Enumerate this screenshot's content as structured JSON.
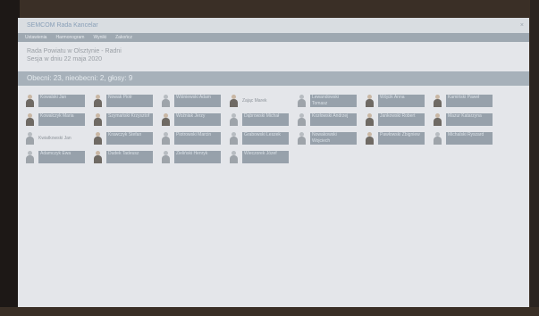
{
  "window": {
    "title": "SEMCOM Rada Kancelar"
  },
  "menu": [
    "Ustawienia",
    "Harmonogram",
    "Wyniki",
    "Zakończ"
  ],
  "header": {
    "org": "Rada Powiatu w Olsztynie - Radni",
    "session": "Sesja w dniu 22 maja 2020"
  },
  "section": {
    "label": "Obecni: 23, nieobecni: 2, głosy: 9"
  },
  "people": [
    {
      "name": "Kowalski Jan",
      "style": "box",
      "avatar": "photo"
    },
    {
      "name": "Nowak Piotr",
      "style": "box",
      "avatar": "photo"
    },
    {
      "name": "Wiśniewski Adam",
      "style": "box",
      "avatar": "gray"
    },
    {
      "name": "Zając Marek",
      "style": "plain",
      "avatar": "photo"
    },
    {
      "name": "Lewandowski Tomasz",
      "style": "box",
      "avatar": "gray"
    },
    {
      "name": "Wójcik Anna",
      "style": "box",
      "avatar": "photo"
    },
    {
      "name": "Kamiński Paweł",
      "style": "box",
      "avatar": "photo"
    },
    {
      "name": "Kowalczyk Maria",
      "style": "box",
      "avatar": "photo"
    },
    {
      "name": "Szymański Krzysztof",
      "style": "box",
      "avatar": "photo"
    },
    {
      "name": "Woźniak Jerzy",
      "style": "box",
      "avatar": "photo"
    },
    {
      "name": "Dąbrowski Michał",
      "style": "box",
      "avatar": "gray"
    },
    {
      "name": "Kozłowski Andrzej",
      "style": "box",
      "avatar": "gray"
    },
    {
      "name": "Jankowski Robert",
      "style": "box",
      "avatar": "photo"
    },
    {
      "name": "Mazur Katarzyna",
      "style": "box",
      "avatar": "photo"
    },
    {
      "name": "Kwiatkowski Jan",
      "style": "plain",
      "avatar": "gray"
    },
    {
      "name": "Krawczyk Stefan",
      "style": "box",
      "avatar": "photo"
    },
    {
      "name": "Piotrowski Marcin",
      "style": "box",
      "avatar": "gray"
    },
    {
      "name": "Grabowski Leszek",
      "style": "box",
      "avatar": "gray"
    },
    {
      "name": "Nowakowski Wojciech",
      "style": "box",
      "avatar": "gray"
    },
    {
      "name": "Pawłowski Zbigniew",
      "style": "box",
      "avatar": "photo"
    },
    {
      "name": "Michalski Ryszard",
      "style": "box",
      "avatar": "gray"
    },
    {
      "name": "Adamczyk Ewa",
      "style": "box",
      "avatar": "gray"
    },
    {
      "name": "Dudek Tadeusz",
      "style": "box",
      "avatar": "photo"
    },
    {
      "name": "Zieliński Henryk",
      "style": "box",
      "avatar": "gray"
    },
    {
      "name": "Wieczorek Józef",
      "style": "box",
      "avatar": "gray"
    }
  ],
  "colors": {
    "accent_bar": "#a7b1ba",
    "name_box": "#97a1ab",
    "background": "#e4e6ea"
  }
}
